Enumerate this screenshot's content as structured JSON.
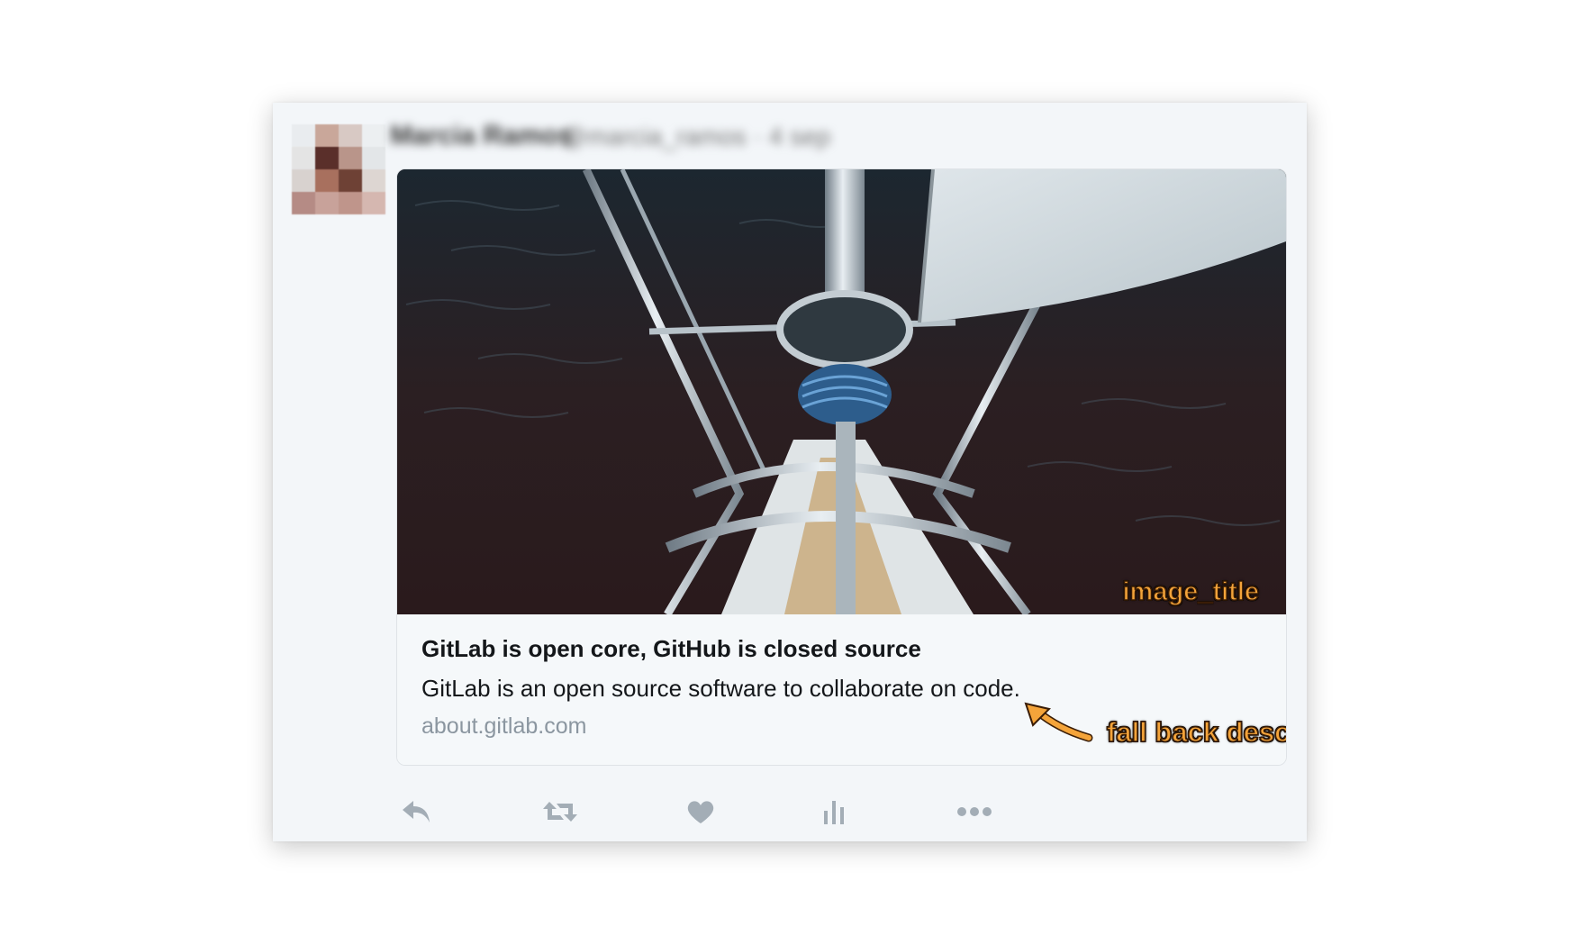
{
  "tweet": {
    "author_name": "Marcia Ramos",
    "author_handle": "@marcia_ramos · 4 sep",
    "card": {
      "title": "GitLab is open core, GitHub is closed source",
      "description": "GitLab is an open source software to collaborate on code.",
      "domain": "about.gitlab.com"
    },
    "actions": [
      {
        "icon": "reply-icon"
      },
      {
        "icon": "retweet-icon"
      },
      {
        "icon": "heart-icon"
      },
      {
        "icon": "analytics-icon"
      },
      {
        "icon": "more-icon"
      }
    ]
  },
  "annotations": {
    "image_title": "image_title",
    "fallback_description": "fall back description",
    "color": "#f4a43a"
  },
  "colors": {
    "icon_gray": "#a3adb6",
    "panel_bg": "#f3f6f9",
    "card_border": "#dfe3e7"
  }
}
